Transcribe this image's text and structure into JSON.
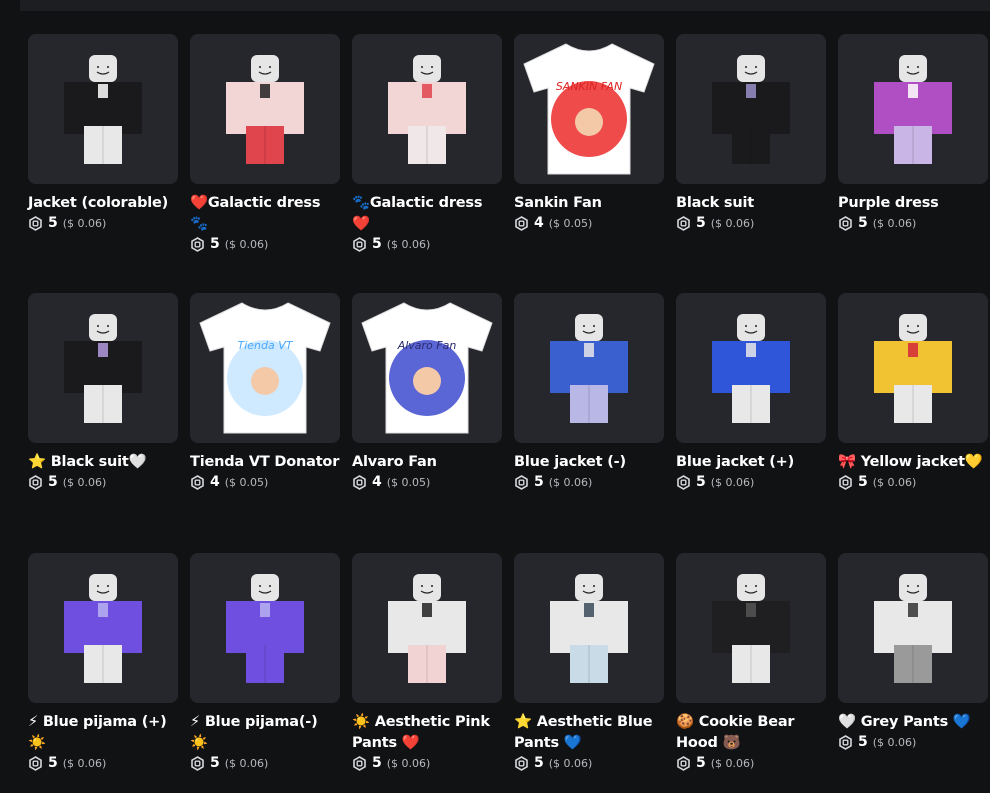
{
  "items": [
    {
      "name": "Jacket (colorable)",
      "price": "5",
      "usd": "($ 0.06)",
      "thumb": {
        "kind": "avatar",
        "shirt": "#1a1a1c",
        "pants": "#e8e8e8",
        "accent": "#ffffff"
      }
    },
    {
      "name": "❤️Galactic dress 🐾",
      "price": "5",
      "usd": "($ 0.06)",
      "thumb": {
        "kind": "avatar",
        "shirt": "#f2d6d6",
        "pants": "#e0444d",
        "accent": "#222222"
      }
    },
    {
      "name": "🐾Galactic dress ❤️",
      "price": "5",
      "usd": "($ 0.06)",
      "thumb": {
        "kind": "avatar",
        "shirt": "#f2d6d6",
        "pants": "#f0e8e8",
        "accent": "#e0444d"
      }
    },
    {
      "name": "Sankin Fan",
      "price": "4",
      "usd": "($ 0.05)",
      "thumb": {
        "kind": "tshirt",
        "circle": "#ef4b4b",
        "text": "SANKIN FAN",
        "textColor": "#d22"
      }
    },
    {
      "name": "Black suit",
      "price": "5",
      "usd": "($ 0.06)",
      "thumb": {
        "kind": "avatar",
        "shirt": "#1a1a1c",
        "pants": "#1a1a1c",
        "accent": "#9a90c8"
      }
    },
    {
      "name": "Purple dress",
      "price": "5",
      "usd": "($ 0.06)",
      "thumb": {
        "kind": "avatar",
        "shirt": "#b04fc4",
        "pants": "#c9b6e6",
        "accent": "#ffffff"
      }
    },
    {
      "name": "⭐ Black suit🤍",
      "price": "5",
      "usd": "($ 0.06)",
      "thumb": {
        "kind": "avatar",
        "shirt": "#1a1a1c",
        "pants": "#e8e8e8",
        "accent": "#b49be0"
      }
    },
    {
      "name": "Tienda VT Donator",
      "price": "4",
      "usd": "($ 0.05)",
      "thumb": {
        "kind": "tshirt",
        "circle": "#cfe9ff",
        "text": "Tienda VT",
        "textColor": "#4aa8ff"
      }
    },
    {
      "name": "Alvaro Fan",
      "price": "4",
      "usd": "($ 0.05)",
      "thumb": {
        "kind": "tshirt",
        "circle": "#5b66d6",
        "text": "Alvaro Fan",
        "textColor": "#2b2b6b"
      }
    },
    {
      "name": "Blue jacket (-)",
      "price": "5",
      "usd": "($ 0.06)",
      "thumb": {
        "kind": "avatar",
        "shirt": "#3a5fcf",
        "pants": "#b9b7e6",
        "accent": "#e8e8e8"
      }
    },
    {
      "name": "Blue jacket (+)",
      "price": "5",
      "usd": "($ 0.06)",
      "thumb": {
        "kind": "avatar",
        "shirt": "#2f55d8",
        "pants": "#e8e8e8",
        "accent": "#e8e8e8"
      }
    },
    {
      "name": "🎀 Yellow jacket💛",
      "price": "5",
      "usd": "($ 0.06)",
      "thumb": {
        "kind": "avatar",
        "shirt": "#f1c232",
        "pants": "#e8e8e8",
        "accent": "#d4283a"
      }
    },
    {
      "name": "⚡ Blue pijama (+) ☀️",
      "price": "5",
      "usd": "($ 0.06)",
      "thumb": {
        "kind": "avatar",
        "shirt": "#6f4fe0",
        "pants": "#e8e8e8",
        "accent": "#b7b0ef"
      }
    },
    {
      "name": "⚡ Blue pijama(-) ☀️",
      "price": "5",
      "usd": "($ 0.06)",
      "thumb": {
        "kind": "avatar",
        "shirt": "#6f4fe0",
        "pants": "#6f4fe0",
        "accent": "#b7b0ef"
      }
    },
    {
      "name": "☀️ Aesthetic Pink Pants ❤️",
      "price": "5",
      "usd": "($ 0.06)",
      "thumb": {
        "kind": "avatar",
        "shirt": "#e8e8e8",
        "pants": "#f2d3d3",
        "accent": "#222222"
      }
    },
    {
      "name": "⭐ Aesthetic Blue Pants 💙",
      "price": "5",
      "usd": "($ 0.06)",
      "thumb": {
        "kind": "avatar",
        "shirt": "#e8e8e8",
        "pants": "#c9dbe6",
        "accent": "#3a4a5a"
      }
    },
    {
      "name": "🍪 Cookie Bear Hood 🐻",
      "price": "5",
      "usd": "($ 0.06)",
      "thumb": {
        "kind": "avatar",
        "shirt": "#1f1f22",
        "pants": "#e8e8e8",
        "accent": "#555555"
      }
    },
    {
      "name": "🤍 Grey Pants 💙",
      "price": "5",
      "usd": "($ 0.06)",
      "thumb": {
        "kind": "avatar",
        "shirt": "#e8e8e8",
        "pants": "#9a9a9a",
        "accent": "#333333"
      }
    }
  ],
  "colors": {
    "background": "#111214",
    "card": "#26272c",
    "usd_text": "#b8b9bd"
  },
  "icons": {
    "currency": "robux-icon"
  }
}
